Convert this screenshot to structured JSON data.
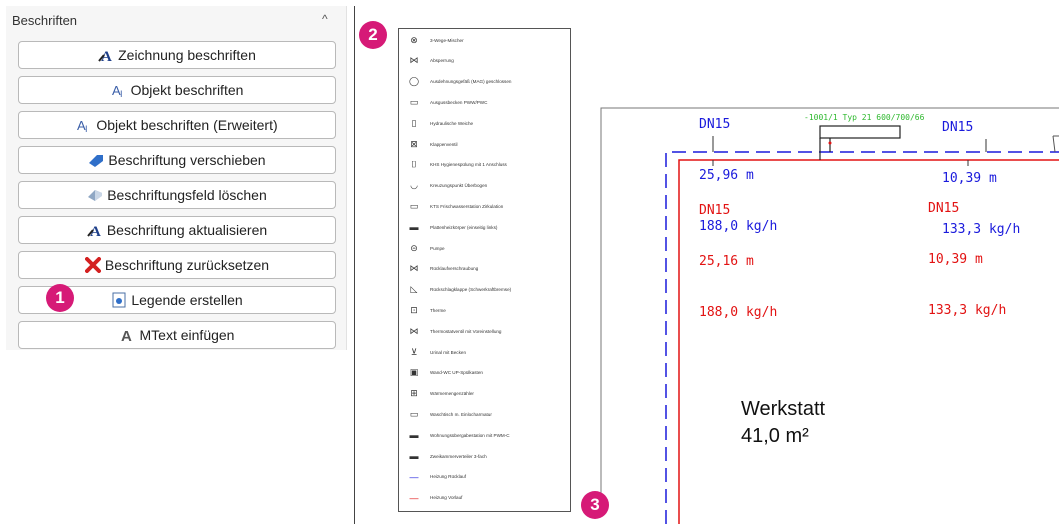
{
  "panel": {
    "title": "Beschriften",
    "buttons": [
      {
        "label": "Zeichnung beschriften"
      },
      {
        "label": "Objekt beschriften"
      },
      {
        "label": "Objekt beschriften (Erweitert)"
      },
      {
        "label": "Beschriftung verschieben"
      },
      {
        "label": "Beschriftungsfeld löschen"
      },
      {
        "label": "Beschriftung aktualisieren"
      },
      {
        "label": "Beschriftung zurücksetzen"
      },
      {
        "label": "Legende erstellen"
      },
      {
        "label": "MText einfügen"
      }
    ]
  },
  "callouts": [
    "1",
    "2",
    "3"
  ],
  "legend": {
    "items": [
      "3-Wege-Mischer",
      "Absperrung",
      "Ausdehnungsgefäß (MAG) geschlossen",
      "Ausgussbecken PWW/PWC",
      "Hydraulische Weiche",
      "Klappenventil",
      "KHS Hygienespülung mit 1 Anschluss",
      "Kreuzungspunkt Überbogen",
      "KTS Frischwasserstation Zirkulation",
      "Plattenheizkörper (einseitig links)",
      "Pumpe",
      "Rücklaufverschraubung",
      "Rückschlagklappe (Schwerkraftbremse)",
      "Therme",
      "Thermostatventil mit Voreinstellung",
      "Urinal mit Becken",
      "Wand-WC UP-Spülkasten",
      "Wärmemengenzähler",
      "Waschtisch m. Einlocharmatur",
      "Wohnungsübergabestation mit PWM-C",
      "Zweikammerverteiler 3-fach",
      "Heizung Rücklauf",
      "Heizung Vorlauf"
    ]
  },
  "drawing": {
    "pipe_labels": [
      {
        "dn": "DN15",
        "len": "25,96 m",
        "flow": "188,0 kg/h"
      },
      {
        "dn": "DN15",
        "len": "10,39 m",
        "flow": "133,3 kg/h"
      },
      {
        "dn": "DN15",
        "len": "25,16 m",
        "flow": "188,0 kg/h"
      },
      {
        "dn": "DN15",
        "len": "10,39 m",
        "flow": "133,3 kg/h"
      }
    ],
    "component_label": "-1001/1 Typ 21 600/700/66",
    "room": {
      "name": "Werkstatt",
      "area": "41,0 m²"
    }
  },
  "colors": {
    "accent": "#d61a77",
    "return_line": "#1a1adc",
    "supply_line": "#e21212",
    "component": "#2db82d"
  }
}
